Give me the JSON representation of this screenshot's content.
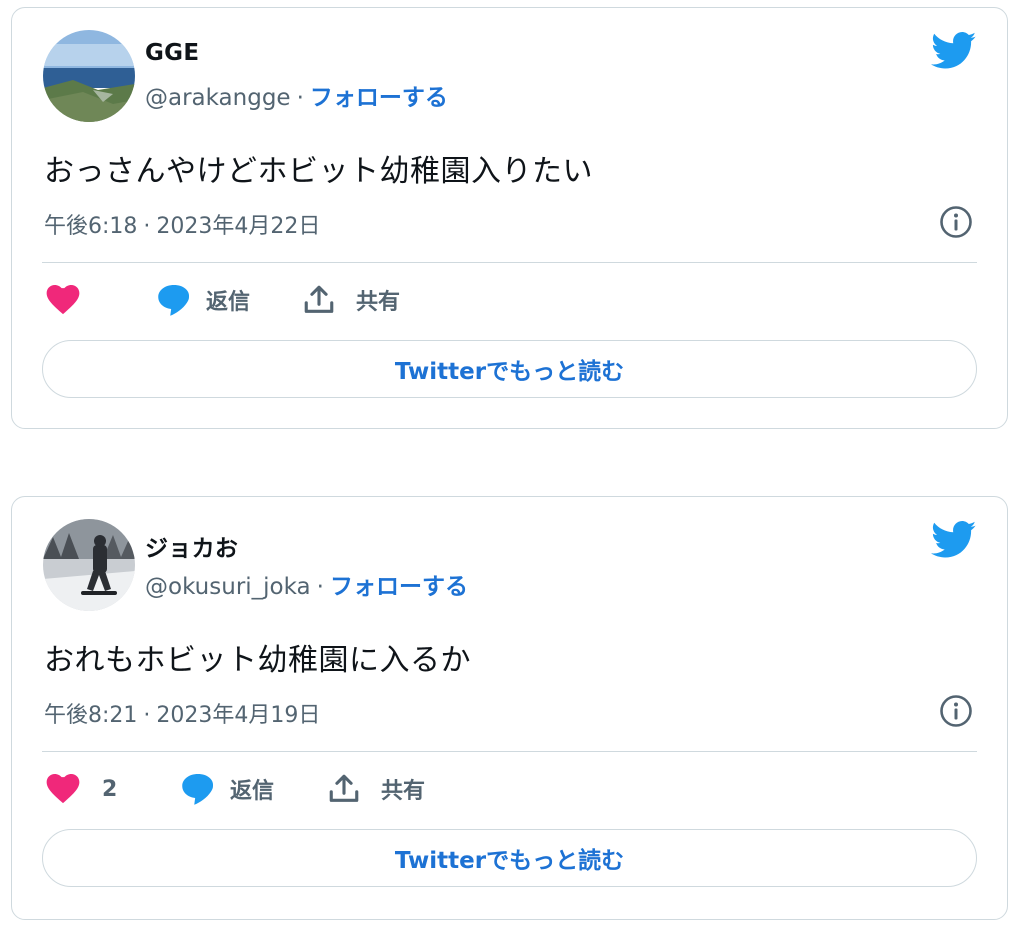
{
  "colors": {
    "accent": "#1d9bf0",
    "link": "#1d72d4",
    "like": "#f0287a",
    "border": "#cfd9de",
    "secondary_text": "#536471"
  },
  "tweets": [
    {
      "name": "GGE",
      "handle": "@arakangge",
      "separator": "·",
      "follow_label": "フォローする",
      "text": "おっさんやけどホビット幼稚園入りたい",
      "time": "午後6:18",
      "date": "2023年4月22日",
      "like_count": "",
      "reply_label": "返信",
      "share_label": "共有",
      "read_more_label": "Twitterでもっと読む"
    },
    {
      "name": "ジョカお",
      "handle": "@okusuri_joka",
      "separator": "·",
      "follow_label": "フォローする",
      "text": "おれもホビット幼稚園に入るか",
      "time": "午後8:21",
      "date": "2023年4月19日",
      "like_count": "2",
      "reply_label": "返信",
      "share_label": "共有",
      "read_more_label": "Twitterでもっと読む"
    }
  ]
}
